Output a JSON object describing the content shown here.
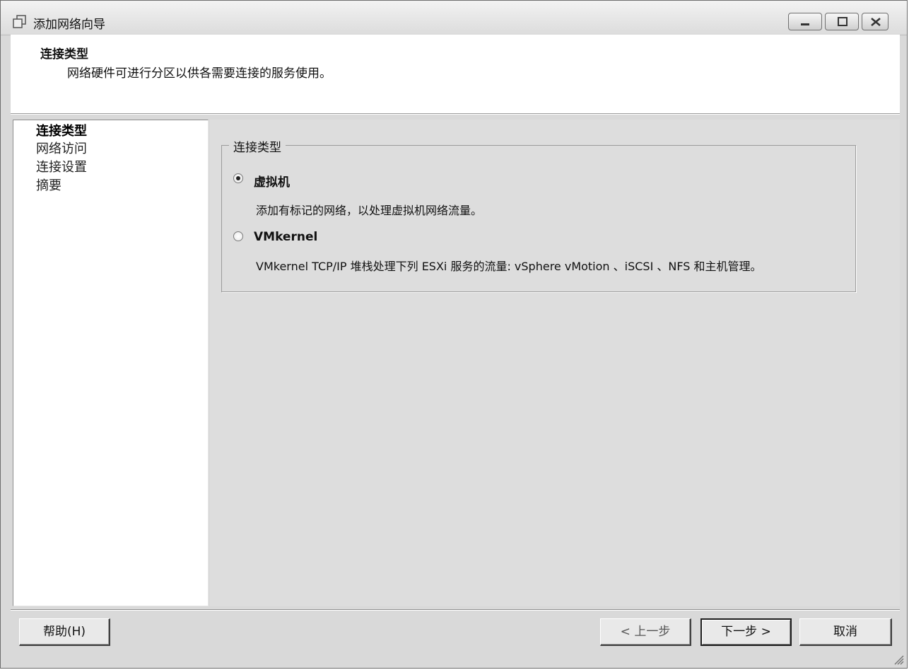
{
  "window": {
    "title": "添加网络向导"
  },
  "header": {
    "title": "连接类型",
    "description": "网络硬件可进行分区以供各需要连接的服务使用。"
  },
  "nav": {
    "items": [
      {
        "label": "连接类型",
        "active": true
      },
      {
        "label": "网络访问",
        "active": false
      },
      {
        "label": "连接设置",
        "active": false
      },
      {
        "label": "摘要",
        "active": false
      }
    ]
  },
  "group": {
    "legend": "连接类型",
    "options": [
      {
        "label": "虚拟机",
        "selected": true,
        "description": "添加有标记的网络，以处理虚拟机网络流量。"
      },
      {
        "label": "VMkernel",
        "selected": false,
        "description": "VMkernel TCP/IP 堆栈处理下列 ESXi 服务的流量: vSphere vMotion 、iSCSI 、NFS 和主机管理。"
      }
    ]
  },
  "buttons": {
    "help": "帮助(H)",
    "back": "< 上一步",
    "next": "下一步 >",
    "cancel": "取消"
  }
}
